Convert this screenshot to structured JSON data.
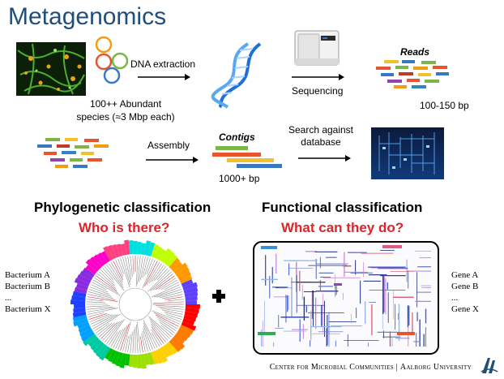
{
  "title": "Metagenomics",
  "workflow": {
    "dna_extraction_label": "DNA extraction",
    "species_line1": "100++ Abundant",
    "species_line2": "species (≈3 Mbp each)",
    "sequencing_label": "Sequencing",
    "reads_label": "Reads",
    "reads_length": "100-150 bp",
    "assembly_label": "Assembly",
    "contigs_label": "Contigs",
    "contigs_length": "1000+ bp",
    "search_line1": "Search against",
    "search_line2": "database"
  },
  "phylogenetic": {
    "heading": "Phylogenetic classification",
    "question": "Who is there?",
    "list": [
      "Bacterium A",
      "Bacterium B",
      "...",
      "Bacterium X"
    ]
  },
  "functional": {
    "heading": "Functional classification",
    "question": "What can they do?",
    "list": [
      "Gene A",
      "Gene B",
      "...",
      "Gene X"
    ]
  },
  "footer": {
    "center": "Center for Microbial Communities",
    "separator": "|",
    "university": "Aalborg University"
  },
  "colors": {
    "title": "#1f4e79",
    "question": "#d9262b",
    "fragment_palette": [
      "#e8542b",
      "#f2c12e",
      "#7ab648",
      "#3a78c2",
      "#c0392b",
      "#8e44ad",
      "#f39c12",
      "#2e86c1"
    ]
  }
}
